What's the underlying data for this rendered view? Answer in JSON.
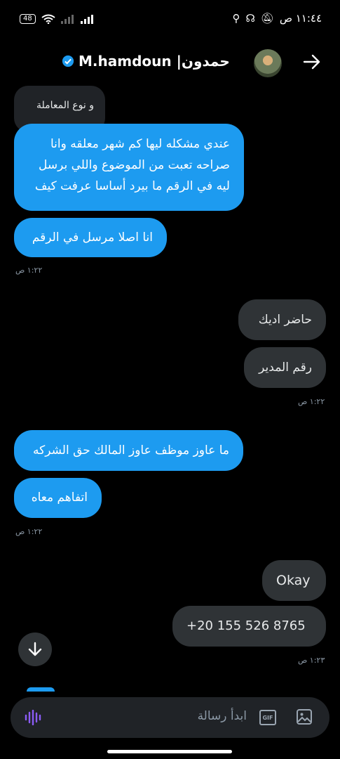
{
  "status": {
    "battery": "48",
    "time": "١١:٤٤ ص"
  },
  "header": {
    "title": "M.hamdoun |حمدون"
  },
  "messages": {
    "quoted": "و نوع المعاملة",
    "m1_l1": "عندي مشكله ليها كم شهر معلقه وانا",
    "m1_l2": "صراحه تعبت من الموضوع واللي برسل",
    "m1_l3": "ليه في الرقم ما بيرد أساسا عرفت كيف",
    "m2": "انا اصلا مرسل في الرقم",
    "t1": "١:٢٢ ص",
    "o1": "حاضر اديك",
    "o2": "رقم المدير",
    "t2": "١:٢٢ ص",
    "m3": "ما عاوز موظف عاوز المالك حق الشركه",
    "m4": "اتفاهم معاه",
    "t3": "١:٢٢ ص",
    "o3": "Okay",
    "o4": "+20 155 526 8765",
    "t4": "١:٢٣ ص"
  },
  "composer": {
    "placeholder": "ابدأ رسالة",
    "gif_label": "GIF"
  },
  "colors": {
    "accent": "#1d9bf0",
    "outgoing": "#2f3336",
    "background": "#000000"
  }
}
